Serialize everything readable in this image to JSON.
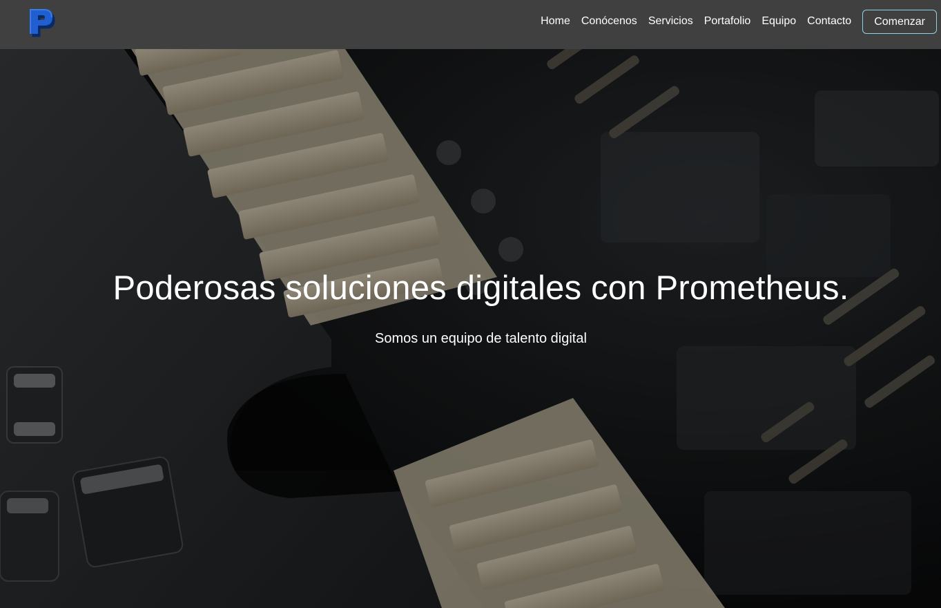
{
  "brand": {
    "logo_letter": "P",
    "logo_color": "#1f5fd1"
  },
  "nav": {
    "items": [
      {
        "label": "Home"
      },
      {
        "label": "Conócenos"
      },
      {
        "label": "Servicios"
      },
      {
        "label": "Portafolio"
      },
      {
        "label": "Equipo"
      },
      {
        "label": "Contacto"
      }
    ],
    "cta_label": "Comenzar",
    "cta_border_color": "#8fd3e6",
    "background_color": "#404040"
  },
  "hero": {
    "title": "Poderosas soluciones digitales con Prometheus.",
    "subtitle": "Somos un equipo de talento digital",
    "background_image": "circuit-board-photo"
  }
}
